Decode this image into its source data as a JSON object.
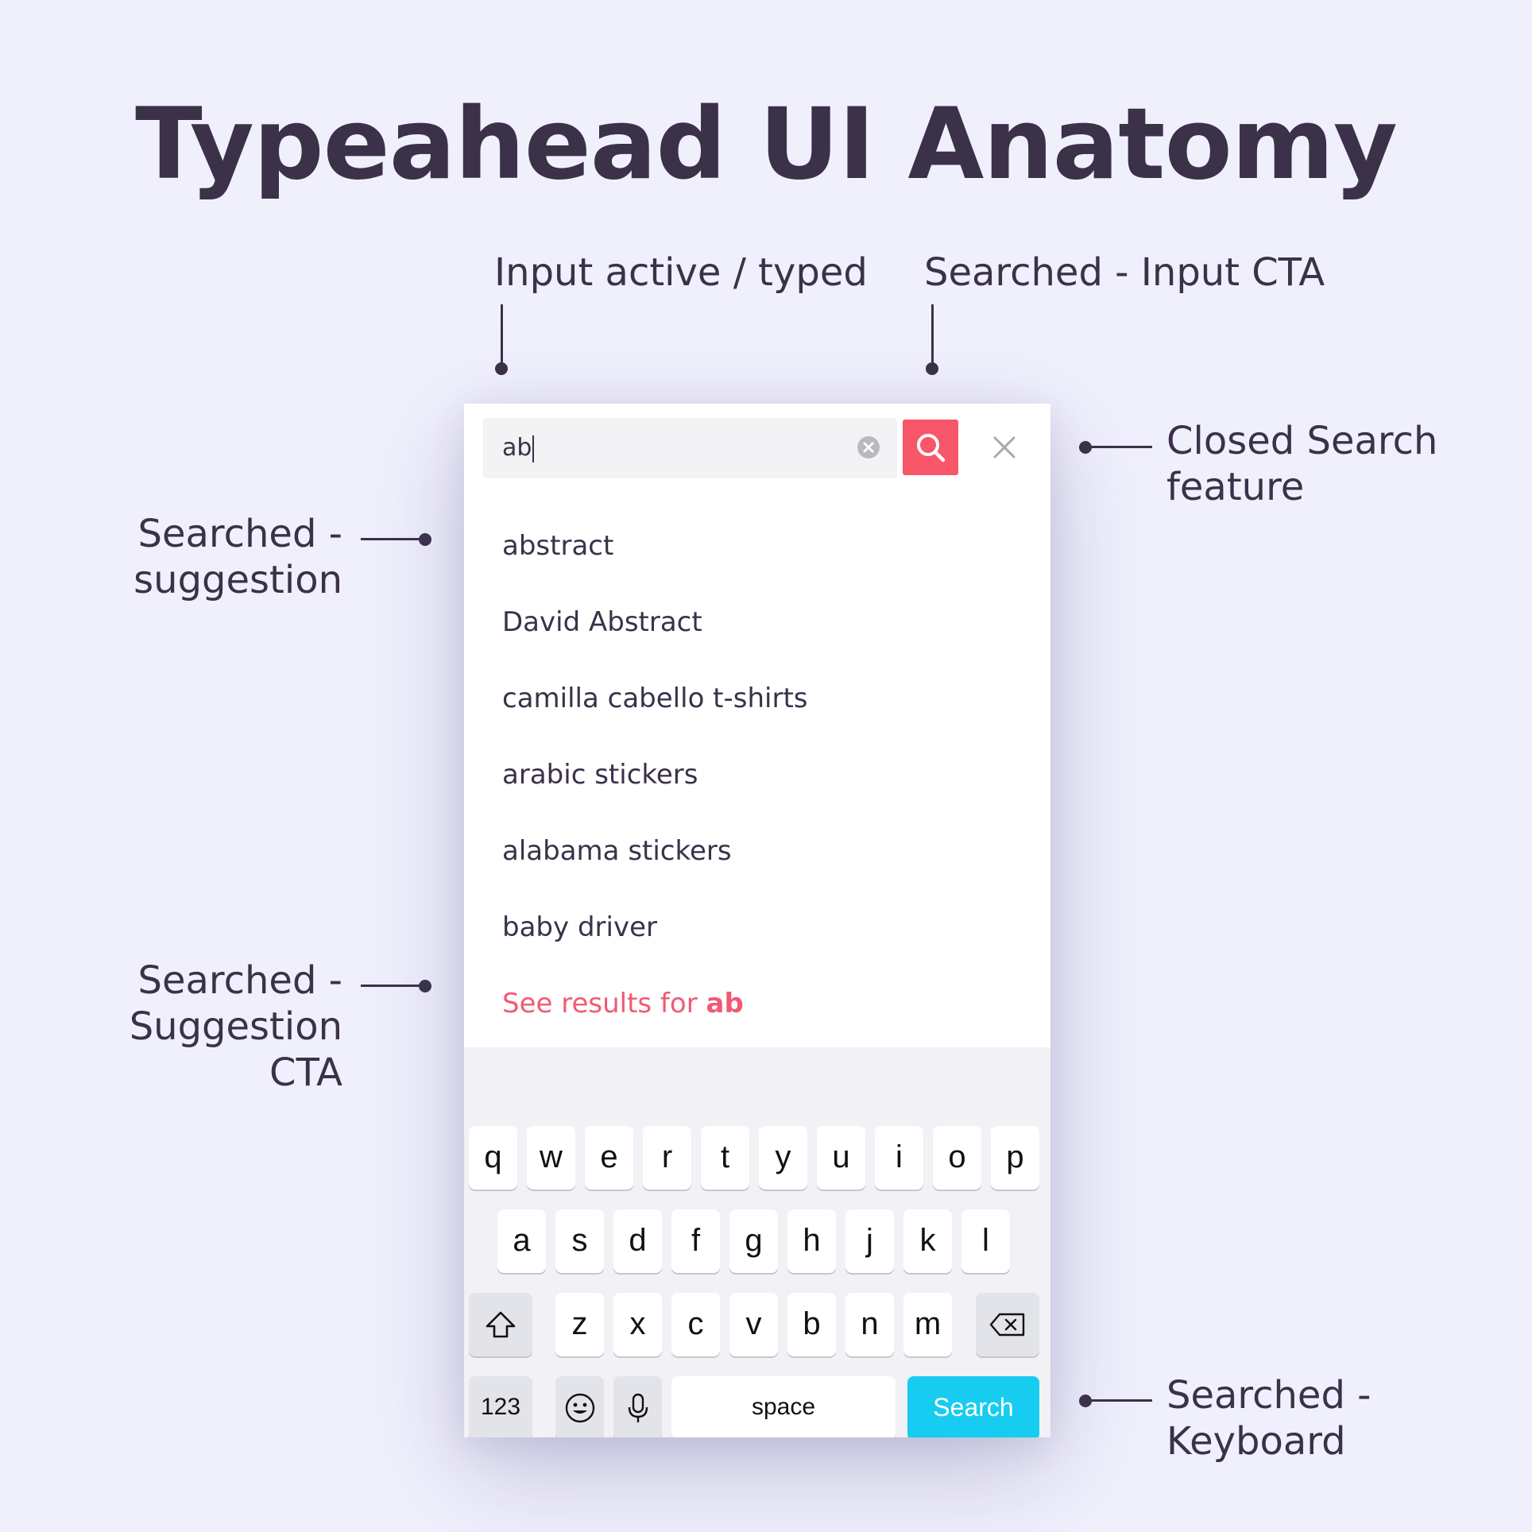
{
  "title": "Typeahead UI Anatomy",
  "annotations": {
    "input_active": "Input active / typed",
    "input_cta": "Searched - Input CTA",
    "closed_search": [
      "Closed Search",
      "feature"
    ],
    "suggestion": [
      "Searched -",
      "suggestion"
    ],
    "suggestion_cta": [
      "Searched -",
      "Suggestion",
      "CTA"
    ],
    "keyboard": [
      "Searched -",
      "Keyboard"
    ]
  },
  "search": {
    "value": "ab",
    "clear_icon": "clear-circle-icon",
    "submit_icon": "search-icon",
    "close_icon": "close-icon",
    "accent_color": "#f75768"
  },
  "suggestions": [
    {
      "pre": "",
      "match": "ab",
      "post": "stract"
    },
    {
      "pre": "David A",
      "match": "b",
      "post": "stract"
    },
    {
      "pre": "camilla ca",
      "match": "b",
      "post": "ello t-shirts"
    },
    {
      "pre": "ara",
      "match": "b",
      "post": "ic stickers"
    },
    {
      "pre": "ala",
      "match": "b",
      "post": "ama stickers"
    },
    {
      "pre": "",
      "match": "b",
      "post": "aby driver"
    }
  ],
  "suggestion_cta": {
    "prefix": "See results for ",
    "query": "ab",
    "color": "#f05a73"
  },
  "keyboard": {
    "row1": [
      "q",
      "w",
      "e",
      "r",
      "t",
      "y",
      "u",
      "i",
      "o",
      "p"
    ],
    "row2": [
      "a",
      "s",
      "d",
      "f",
      "g",
      "h",
      "j",
      "k",
      "l"
    ],
    "row3": [
      "z",
      "x",
      "c",
      "v",
      "b",
      "n",
      "m"
    ],
    "numbers_label": "123",
    "space_label": "space",
    "search_label": "Search",
    "search_color": "#16cdf1"
  }
}
